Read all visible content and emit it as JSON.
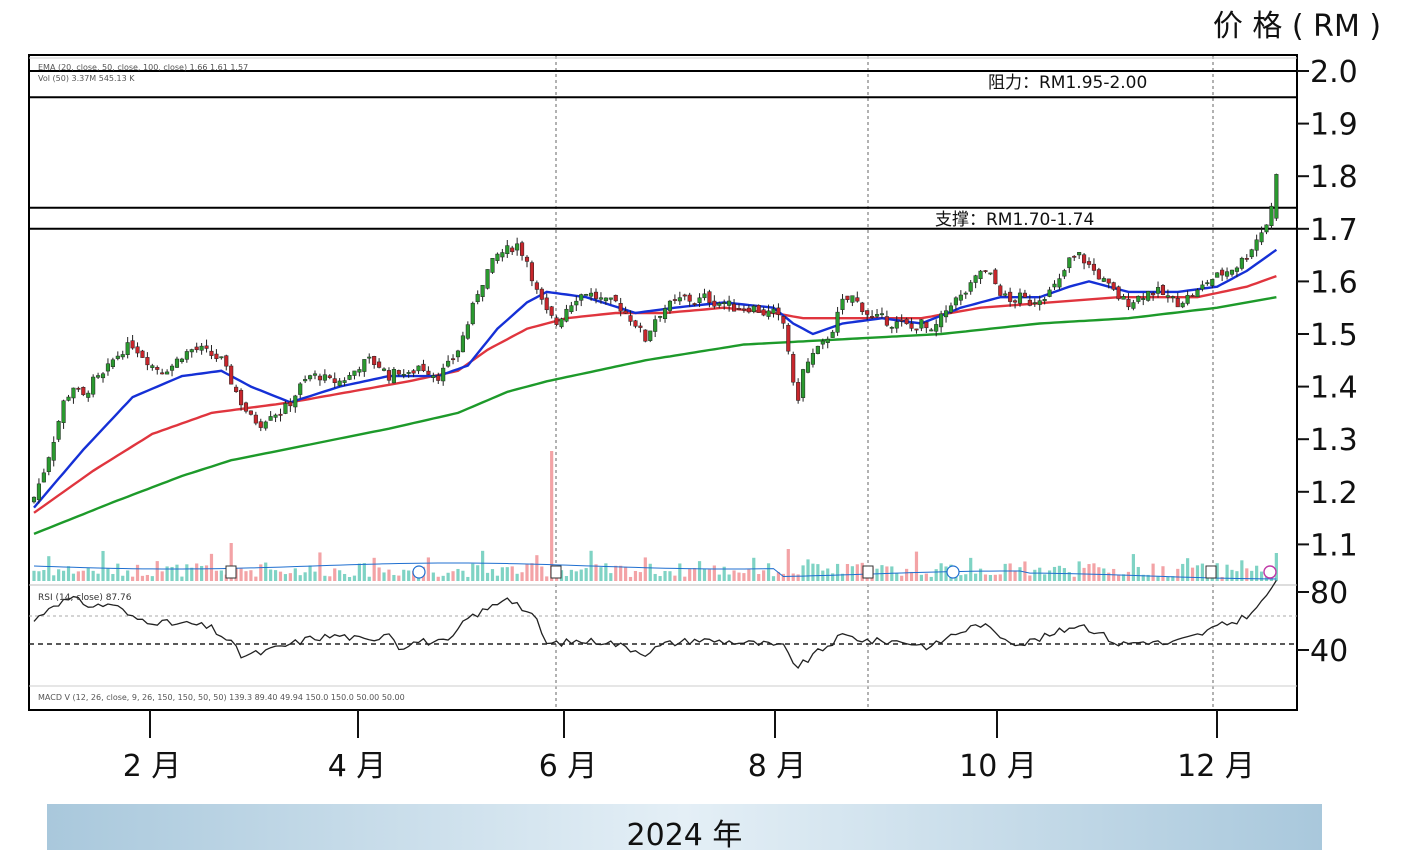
{
  "chart_data": {
    "type": "candlestick",
    "price_axis_title": "价 格 ( RM )",
    "year_label": "2024 年",
    "y_ticks": [
      "2.0",
      "1.9",
      "1.8",
      "1.7",
      "1.6",
      "1.5",
      "1.4",
      "1.3",
      "1.2",
      "1.1"
    ],
    "rsi_ticks": [
      "80",
      "40"
    ],
    "month_labels": [
      "2 月",
      "4 月",
      "6 月",
      "8 月",
      "10 月",
      "12 月"
    ],
    "ylim": [
      1.05,
      2.05
    ],
    "resistance": {
      "label": "阻力：RM1.95-2.00",
      "low": 1.95,
      "high": 2.0
    },
    "support": {
      "label": "支撑：RM1.70-1.74",
      "low": 1.7,
      "high": 1.74
    },
    "legend_lines": [
      "EMA (20, close, 50, close, 100, close)  1.66  1.61  1.57",
      "Vol (50)  3.37M  545.13 K"
    ],
    "rsi_label": "RSI (14, close)  87.76",
    "macd_label": "MACD V (12, 26, close, 9, 26, 150, 150, 50, 50)  139.3  89.40  49.94  150.0  150.0  50.00  50.00",
    "close_anchors": [
      [
        0,
        1.19
      ],
      [
        2,
        1.24
      ],
      [
        4,
        1.3
      ],
      [
        6,
        1.37
      ],
      [
        8,
        1.4
      ],
      [
        10,
        1.38
      ],
      [
        12,
        1.41
      ],
      [
        14,
        1.42
      ],
      [
        16,
        1.45
      ],
      [
        18,
        1.47
      ],
      [
        20,
        1.48
      ],
      [
        22,
        1.46
      ],
      [
        24,
        1.44
      ],
      [
        26,
        1.43
      ],
      [
        28,
        1.44
      ],
      [
        30,
        1.46
      ],
      [
        32,
        1.47
      ],
      [
        34,
        1.47
      ],
      [
        36,
        1.46
      ],
      [
        38,
        1.45
      ],
      [
        40,
        1.41
      ],
      [
        42,
        1.37
      ],
      [
        44,
        1.34
      ],
      [
        46,
        1.33
      ],
      [
        48,
        1.35
      ],
      [
        50,
        1.35
      ],
      [
        52,
        1.37
      ],
      [
        54,
        1.4
      ],
      [
        56,
        1.42
      ],
      [
        58,
        1.42
      ],
      [
        60,
        1.41
      ],
      [
        62,
        1.41
      ],
      [
        64,
        1.42
      ],
      [
        66,
        1.44
      ],
      [
        68,
        1.45
      ],
      [
        70,
        1.44
      ],
      [
        72,
        1.42
      ],
      [
        74,
        1.43
      ],
      [
        76,
        1.42
      ],
      [
        78,
        1.44
      ],
      [
        80,
        1.43
      ],
      [
        82,
        1.42
      ],
      [
        84,
        1.44
      ],
      [
        86,
        1.47
      ],
      [
        88,
        1.52
      ],
      [
        90,
        1.58
      ],
      [
        92,
        1.62
      ],
      [
        94,
        1.65
      ],
      [
        96,
        1.66
      ],
      [
        98,
        1.67
      ],
      [
        100,
        1.64
      ],
      [
        102,
        1.58
      ],
      [
        104,
        1.54
      ],
      [
        106,
        1.52
      ],
      [
        108,
        1.55
      ],
      [
        110,
        1.57
      ],
      [
        112,
        1.58
      ],
      [
        114,
        1.57
      ],
      [
        116,
        1.56
      ],
      [
        118,
        1.56
      ],
      [
        120,
        1.54
      ],
      [
        122,
        1.52
      ],
      [
        124,
        1.49
      ],
      [
        126,
        1.53
      ],
      [
        128,
        1.55
      ],
      [
        130,
        1.56
      ],
      [
        132,
        1.57
      ],
      [
        134,
        1.56
      ],
      [
        136,
        1.57
      ],
      [
        138,
        1.56
      ],
      [
        140,
        1.56
      ],
      [
        142,
        1.55
      ],
      [
        144,
        1.55
      ],
      [
        146,
        1.55
      ],
      [
        148,
        1.54
      ],
      [
        150,
        1.54
      ],
      [
        152,
        1.52
      ],
      [
        153,
        1.47
      ],
      [
        154,
        1.4
      ],
      [
        155,
        1.38
      ],
      [
        156,
        1.43
      ],
      [
        158,
        1.46
      ],
      [
        160,
        1.48
      ],
      [
        162,
        1.51
      ],
      [
        164,
        1.56
      ],
      [
        166,
        1.57
      ],
      [
        168,
        1.55
      ],
      [
        170,
        1.53
      ],
      [
        172,
        1.53
      ],
      [
        174,
        1.52
      ],
      [
        176,
        1.52
      ],
      [
        178,
        1.51
      ],
      [
        180,
        1.52
      ],
      [
        182,
        1.5
      ],
      [
        184,
        1.53
      ],
      [
        186,
        1.56
      ],
      [
        188,
        1.57
      ],
      [
        190,
        1.59
      ],
      [
        192,
        1.62
      ],
      [
        194,
        1.61
      ],
      [
        196,
        1.58
      ],
      [
        198,
        1.56
      ],
      [
        200,
        1.57
      ],
      [
        202,
        1.56
      ],
      [
        204,
        1.57
      ],
      [
        206,
        1.58
      ],
      [
        208,
        1.6
      ],
      [
        210,
        1.64
      ],
      [
        212,
        1.65
      ],
      [
        214,
        1.63
      ],
      [
        216,
        1.61
      ],
      [
        218,
        1.59
      ],
      [
        220,
        1.57
      ],
      [
        222,
        1.56
      ],
      [
        224,
        1.57
      ],
      [
        226,
        1.58
      ],
      [
        228,
        1.58
      ],
      [
        230,
        1.57
      ],
      [
        232,
        1.56
      ],
      [
        234,
        1.57
      ],
      [
        236,
        1.58
      ],
      [
        238,
        1.6
      ],
      [
        240,
        1.61
      ],
      [
        242,
        1.62
      ],
      [
        244,
        1.63
      ],
      [
        246,
        1.65
      ],
      [
        248,
        1.68
      ],
      [
        250,
        1.71
      ],
      [
        251,
        1.74
      ],
      [
        252,
        1.81
      ]
    ],
    "ema_fast_anchors": [
      [
        0,
        1.17
      ],
      [
        10,
        1.28
      ],
      [
        20,
        1.38
      ],
      [
        30,
        1.42
      ],
      [
        38,
        1.43
      ],
      [
        44,
        1.4
      ],
      [
        52,
        1.37
      ],
      [
        62,
        1.4
      ],
      [
        72,
        1.42
      ],
      [
        82,
        1.42
      ],
      [
        88,
        1.44
      ],
      [
        94,
        1.51
      ],
      [
        100,
        1.56
      ],
      [
        104,
        1.58
      ],
      [
        112,
        1.57
      ],
      [
        122,
        1.54
      ],
      [
        130,
        1.55
      ],
      [
        140,
        1.56
      ],
      [
        150,
        1.55
      ],
      [
        154,
        1.52
      ],
      [
        158,
        1.5
      ],
      [
        164,
        1.52
      ],
      [
        172,
        1.53
      ],
      [
        180,
        1.52
      ],
      [
        188,
        1.55
      ],
      [
        196,
        1.57
      ],
      [
        204,
        1.57
      ],
      [
        210,
        1.59
      ],
      [
        214,
        1.6
      ],
      [
        222,
        1.58
      ],
      [
        232,
        1.58
      ],
      [
        240,
        1.59
      ],
      [
        246,
        1.62
      ],
      [
        252,
        1.66
      ]
    ],
    "ema_mid_anchors": [
      [
        0,
        1.16
      ],
      [
        12,
        1.24
      ],
      [
        24,
        1.31
      ],
      [
        36,
        1.35
      ],
      [
        44,
        1.36
      ],
      [
        52,
        1.37
      ],
      [
        64,
        1.39
      ],
      [
        76,
        1.41
      ],
      [
        86,
        1.43
      ],
      [
        92,
        1.47
      ],
      [
        100,
        1.51
      ],
      [
        108,
        1.53
      ],
      [
        118,
        1.54
      ],
      [
        128,
        1.54
      ],
      [
        140,
        1.55
      ],
      [
        150,
        1.54
      ],
      [
        156,
        1.53
      ],
      [
        164,
        1.53
      ],
      [
        180,
        1.53
      ],
      [
        192,
        1.55
      ],
      [
        206,
        1.56
      ],
      [
        220,
        1.57
      ],
      [
        236,
        1.57
      ],
      [
        246,
        1.59
      ],
      [
        252,
        1.61
      ]
    ],
    "ema_slow_anchors": [
      [
        0,
        1.12
      ],
      [
        16,
        1.18
      ],
      [
        30,
        1.23
      ],
      [
        40,
        1.26
      ],
      [
        56,
        1.29
      ],
      [
        72,
        1.32
      ],
      [
        86,
        1.35
      ],
      [
        96,
        1.39
      ],
      [
        104,
        1.41
      ],
      [
        124,
        1.45
      ],
      [
        144,
        1.48
      ],
      [
        164,
        1.49
      ],
      [
        184,
        1.5
      ],
      [
        204,
        1.52
      ],
      [
        222,
        1.53
      ],
      [
        240,
        1.55
      ],
      [
        252,
        1.57
      ]
    ],
    "rsi_anchors": [
      [
        0,
        60
      ],
      [
        4,
        72
      ],
      [
        8,
        75
      ],
      [
        12,
        70
      ],
      [
        16,
        72
      ],
      [
        20,
        62
      ],
      [
        24,
        60
      ],
      [
        28,
        58
      ],
      [
        32,
        58
      ],
      [
        36,
        55
      ],
      [
        40,
        45
      ],
      [
        42,
        36
      ],
      [
        46,
        38
      ],
      [
        50,
        42
      ],
      [
        56,
        48
      ],
      [
        62,
        50
      ],
      [
        68,
        46
      ],
      [
        72,
        53
      ],
      [
        74,
        42
      ],
      [
        78,
        46
      ],
      [
        84,
        45
      ],
      [
        88,
        62
      ],
      [
        92,
        68
      ],
      [
        96,
        77
      ],
      [
        98,
        72
      ],
      [
        102,
        60
      ],
      [
        104,
        44
      ],
      [
        110,
        46
      ],
      [
        116,
        46
      ],
      [
        120,
        42
      ],
      [
        124,
        38
      ],
      [
        128,
        44
      ],
      [
        134,
        47
      ],
      [
        140,
        46
      ],
      [
        148,
        44
      ],
      [
        152,
        42
      ],
      [
        155,
        28
      ],
      [
        158,
        36
      ],
      [
        164,
        50
      ],
      [
        170,
        46
      ],
      [
        176,
        46
      ],
      [
        182,
        42
      ],
      [
        186,
        50
      ],
      [
        192,
        58
      ],
      [
        196,
        50
      ],
      [
        200,
        44
      ],
      [
        206,
        50
      ],
      [
        212,
        58
      ],
      [
        216,
        52
      ],
      [
        220,
        44
      ],
      [
        226,
        46
      ],
      [
        230,
        44
      ],
      [
        236,
        50
      ],
      [
        240,
        56
      ],
      [
        244,
        60
      ],
      [
        248,
        68
      ],
      [
        252,
        88
      ]
    ]
  }
}
